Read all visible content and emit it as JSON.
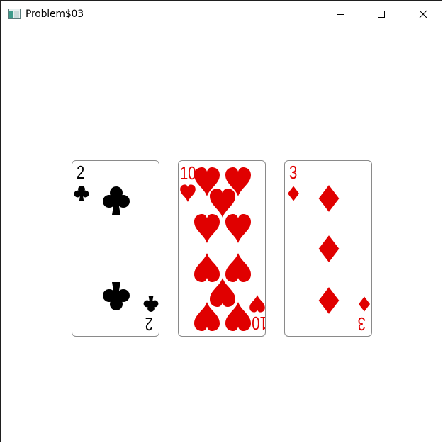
{
  "window": {
    "title": "Problem$03",
    "controls": {
      "minimize": "minimize-icon",
      "maximize": "maximize-icon",
      "close": "close-icon"
    }
  },
  "cards": [
    {
      "rank": "2",
      "suit": "clubs",
      "color": "#000000"
    },
    {
      "rank": "10",
      "suit": "hearts",
      "color": "#e00000"
    },
    {
      "rank": "3",
      "suit": "diamonds",
      "color": "#e00000"
    }
  ]
}
